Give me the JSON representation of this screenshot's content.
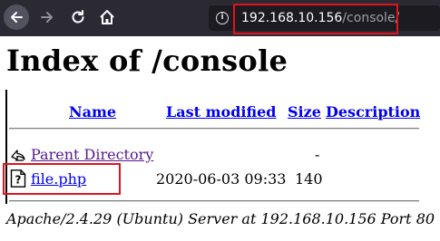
{
  "browser": {
    "url_host": "192.168.10.156",
    "url_path": "/console/",
    "toolbar_bg": "#2b2a33",
    "highlight_color": "#e0141e"
  },
  "page": {
    "title": "Index of /console",
    "columns": {
      "name": "Name",
      "last_modified": "Last modified",
      "size": "Size",
      "description": "Description"
    },
    "rows": [
      {
        "icon": "back-arrow-icon",
        "name": "Parent Directory",
        "modified": "",
        "size": "-",
        "description": "",
        "visited": true
      },
      {
        "icon": "unknown-file-icon",
        "name": "file.php",
        "modified": "2020-06-03 09:33",
        "size": "140",
        "description": "",
        "visited": false
      }
    ],
    "address": "Apache/2.4.29 (Ubuntu) Server at 192.168.10.156 Port 80"
  }
}
